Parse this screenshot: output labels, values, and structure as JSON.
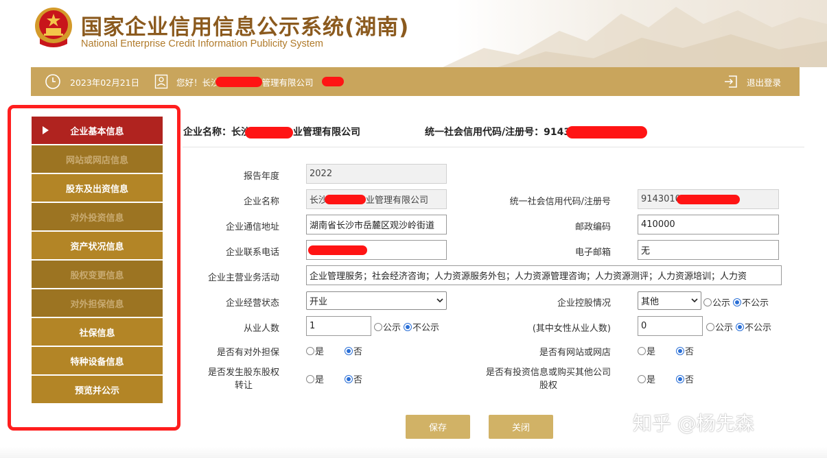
{
  "header": {
    "title_cn": "国家企业信用信息公示系统(湖南)",
    "title_en": "National Enterprise Credit Information Publicity System"
  },
  "topbar": {
    "date": "2023年02月21日",
    "greeting_prefix": "您好！长沙",
    "greeting_suffix": "管理有限公司",
    "logout": "退出登录"
  },
  "sidebar": {
    "items": [
      {
        "label": "企业基本信息",
        "state": "active"
      },
      {
        "label": "网站或网店信息",
        "state": "disabled"
      },
      {
        "label": "股东及出资信息",
        "state": "normal"
      },
      {
        "label": "对外投资信息",
        "state": "disabled"
      },
      {
        "label": "资产状况信息",
        "state": "normal"
      },
      {
        "label": "股权变更信息",
        "state": "disabled"
      },
      {
        "label": "对外担保信息",
        "state": "disabled"
      },
      {
        "label": "社保信息",
        "state": "normal"
      },
      {
        "label": "特种设备信息",
        "state": "normal"
      },
      {
        "label": "预览并公示",
        "state": "normal"
      }
    ]
  },
  "company": {
    "name_label": "企业名称：",
    "name_prefix": "长沙",
    "name_suffix": "业管理有限公司",
    "code_label": "统一社会信用代码/注册号：",
    "code_prefix": "9143"
  },
  "form": {
    "report_year": {
      "label": "报告年度",
      "value": "2022"
    },
    "name": {
      "label": "企业名称",
      "value_prefix": "长沙",
      "value_suffix": "业管理有限公司"
    },
    "credit_code": {
      "label": "统一社会信用代码/注册号",
      "value_prefix": "9143010"
    },
    "address": {
      "label": "企业通信地址",
      "value": "湖南省长沙市岳麓区观沙岭街道"
    },
    "postcode": {
      "label": "邮政编码",
      "value": "410000"
    },
    "phone": {
      "label": "企业联系电话"
    },
    "email": {
      "label": "电子邮箱",
      "value": "无"
    },
    "business": {
      "label": "企业主营业务活动",
      "value": "企业管理服务；社会经济咨询；人力资源服务外包；人力资源管理咨询；人力资源测评；人力资源培训；人力资"
    },
    "status": {
      "label": "企业经营状态",
      "value": "开业"
    },
    "holding": {
      "label": "企业控股情况",
      "value": "其他"
    },
    "employees": {
      "label": "从业人数",
      "value": "1"
    },
    "female_employees": {
      "label": "(其中女性从业人数)",
      "value": "0"
    },
    "guarantee": {
      "label": "是否有对外担保"
    },
    "website": {
      "label": "是否有网站或网店"
    },
    "equity_transfer": {
      "label_line1": "是否发生股东股权",
      "label_line2": "转让"
    },
    "investment": {
      "label_line1": "是否有投资信息或购买其他公司",
      "label_line2": "股权"
    },
    "opt_public": "公示",
    "opt_private": "不公示",
    "opt_yes": "是",
    "opt_no": "否"
  },
  "buttons": {
    "save": "保存",
    "close": "关闭"
  },
  "watermark": "知乎 @杨先森",
  "colors": {
    "gold": "#c9a55c",
    "active_red": "#b0231f",
    "outline_red": "#ff1e1e",
    "radio_blue": "#2a6fd6"
  }
}
